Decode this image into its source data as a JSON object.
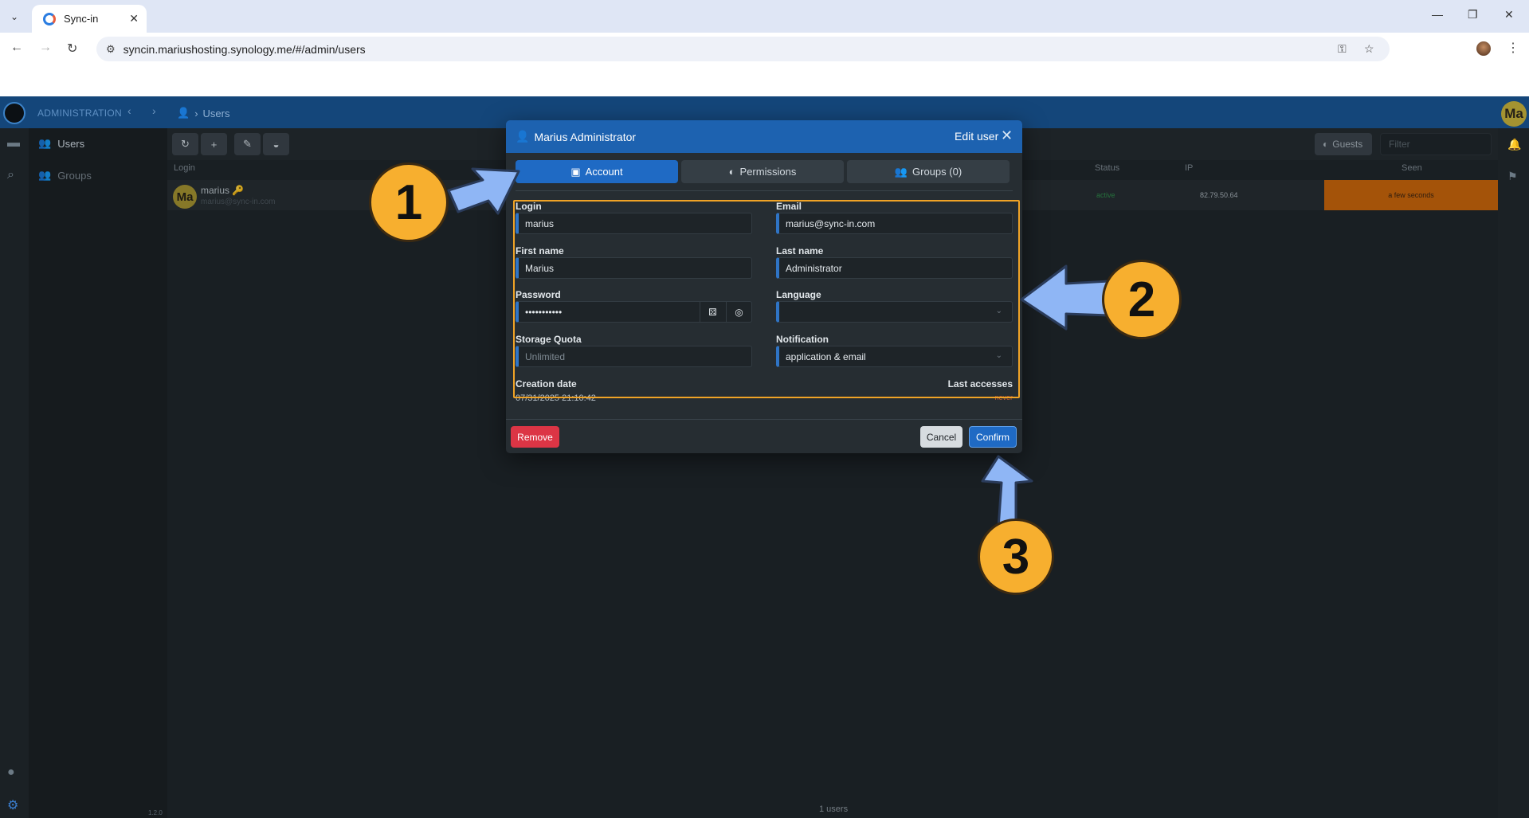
{
  "browser": {
    "tab_title": "Sync-in",
    "url": "syncin.mariushosting.synology.me/#/admin/users"
  },
  "app": {
    "section": "ADMINISTRATION",
    "breadcrumb": "Users",
    "avatar_initials": "Ma",
    "version": "1.2.0"
  },
  "sidebar": {
    "items": [
      {
        "label": "Users"
      },
      {
        "label": "Groups"
      }
    ]
  },
  "toolbar": {
    "guests_label": "Guests",
    "filter_placeholder": "Filter"
  },
  "table": {
    "columns": [
      "Login",
      "Status",
      "IP",
      "Seen"
    ],
    "rows": [
      {
        "initials": "Ma",
        "login": "marius",
        "email": "marius@sync-in.com",
        "status": "active",
        "ip": "82.79.50.64",
        "seen": "a few seconds"
      }
    ],
    "footer": "1 users"
  },
  "modal": {
    "title": "Marius Administrator",
    "mode": "Edit user",
    "tabs": [
      {
        "label": "Account"
      },
      {
        "label": "Permissions"
      },
      {
        "label": "Groups (0)"
      }
    ],
    "fields": {
      "login": {
        "label": "Login",
        "value": "marius"
      },
      "email": {
        "label": "Email",
        "value": "marius@sync-in.com"
      },
      "first_name": {
        "label": "First name",
        "value": "Marius"
      },
      "last_name": {
        "label": "Last name",
        "value": "Administrator"
      },
      "password": {
        "label": "Password",
        "value": "•••••••••••"
      },
      "language": {
        "label": "Language",
        "value": ""
      },
      "storage_quota": {
        "label": "Storage Quota",
        "placeholder": "Unlimited"
      },
      "notification": {
        "label": "Notification",
        "value": "application & email"
      }
    },
    "creation_date_label": "Creation date",
    "creation_date": "07/31/2025 21:10:42",
    "last_accesses_label": "Last accesses",
    "last_accesses": "never",
    "buttons": {
      "remove": "Remove",
      "cancel": "Cancel",
      "confirm": "Confirm"
    }
  },
  "annotations": {
    "steps": [
      "1",
      "2",
      "3"
    ],
    "colors": {
      "badge": "#f7af2f",
      "arrow": "#8fb6f5",
      "highlight": "#f0a326"
    }
  }
}
